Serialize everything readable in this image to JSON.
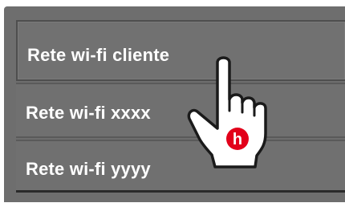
{
  "wifi_list": {
    "items": [
      {
        "label": "Rete wi-fi cliente"
      },
      {
        "label": "Rete wi-fi xxxx"
      },
      {
        "label": "Rete wi-fi yyyy"
      }
    ]
  },
  "pointer": {
    "icon": "pointing-hand-icon",
    "badge_letter": "h",
    "badge_color": "#e2001a"
  },
  "colors": {
    "panel": "#6e6e6e",
    "row": "#707070",
    "text": "#ffffff"
  }
}
